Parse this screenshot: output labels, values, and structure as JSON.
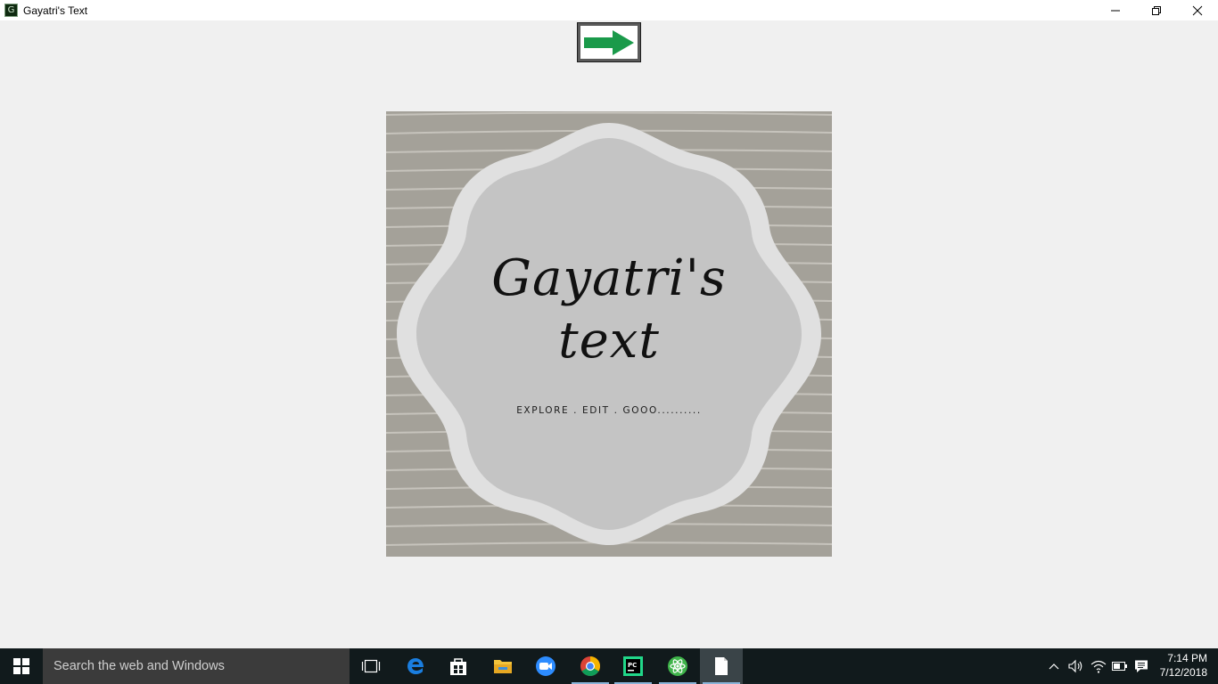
{
  "window": {
    "title": "Gayatri's Text",
    "app_icon_letter": "G",
    "controls": [
      "minimize",
      "restore",
      "close"
    ]
  },
  "next_button": {
    "icon": "green-right-arrow-icon",
    "arrow_color": "#1a9a4a"
  },
  "logo": {
    "title_line1": "Gayatri's",
    "title_line2": "text",
    "tagline": "EXPLORE . EDIT . GOOO..........",
    "colors": {
      "background": "#a4a199",
      "stripes": "#c6c3bc",
      "badge_outer": "#e0e0e0",
      "badge_inner": "#c4c4c4"
    }
  },
  "taskbar": {
    "start_icon": "windows-logo-icon",
    "search_placeholder": "Search the web and Windows",
    "apps": [
      {
        "name": "task-view-icon"
      },
      {
        "name": "edge-icon"
      },
      {
        "name": "store-icon"
      },
      {
        "name": "file-explorer-icon"
      },
      {
        "name": "zoom-icon"
      },
      {
        "name": "chrome-icon"
      },
      {
        "name": "pycharm-icon"
      },
      {
        "name": "atom-icon"
      },
      {
        "name": "document-icon"
      }
    ],
    "tray_icons": [
      "chevron-up-icon",
      "volume-icon",
      "wifi-icon",
      "battery-icon",
      "notifications-icon"
    ],
    "clock": {
      "time": "7:14 PM",
      "date": "7/12/2018"
    }
  }
}
